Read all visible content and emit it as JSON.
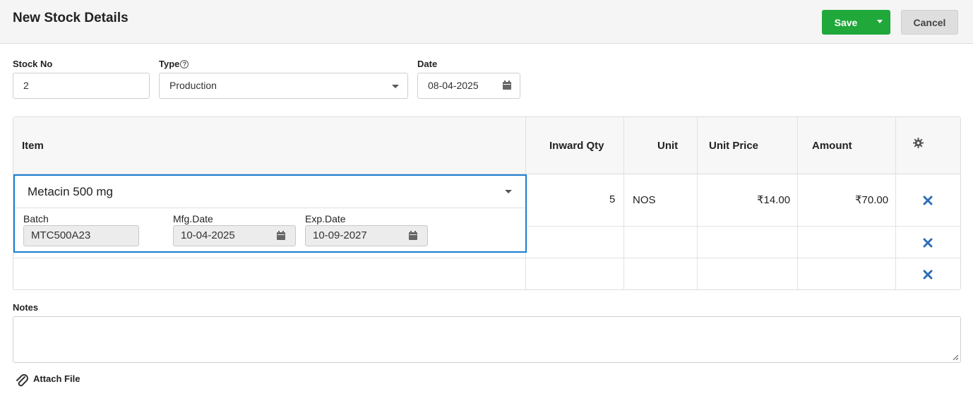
{
  "header": {
    "title": "New Stock Details",
    "save_label": "Save",
    "cancel_label": "Cancel",
    "save_color": "#20a83a"
  },
  "form": {
    "stock_no": {
      "label": "Stock No",
      "value": "2"
    },
    "type": {
      "label": "Type",
      "value": "Production",
      "help_glyph": "?"
    },
    "date": {
      "label": "Date",
      "value": "08-04-2025"
    }
  },
  "grid": {
    "columns": [
      "Item",
      "Inward Qty",
      "Unit",
      "Unit Price",
      "Amount"
    ],
    "settings_icon": "gear-icon",
    "rows": [
      {
        "item": "Metacin 500 mg",
        "inward_qty": "5",
        "unit": "NOS",
        "unit_price": "₹14.00",
        "amount": "₹70.00",
        "batch": {
          "label": "Batch",
          "value": "MTC500A23"
        },
        "mfg_date": {
          "label": "Mfg.Date",
          "value": "10-04-2025"
        },
        "exp_date": {
          "label": "Exp.Date",
          "value": "10-09-2027"
        }
      },
      {
        "item": "",
        "inward_qty": "",
        "unit": "",
        "unit_price": "",
        "amount": ""
      },
      {
        "item": "",
        "inward_qty": "",
        "unit": "",
        "unit_price": "",
        "amount": ""
      }
    ],
    "delete_icon": "close-icon",
    "delete_color": "#2d6db5",
    "focus_color": "#1a7fd1"
  },
  "notes": {
    "label": "Notes",
    "value": ""
  },
  "attach": {
    "label": "Attach File",
    "icon": "paperclip-icon"
  }
}
